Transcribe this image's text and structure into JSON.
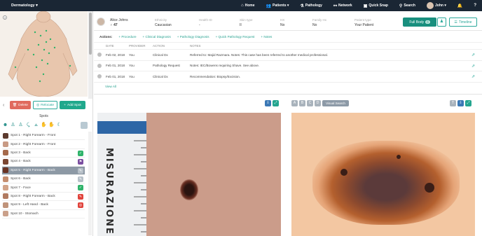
{
  "nav": {
    "brand": "Dermatology ▾",
    "items": [
      {
        "label": "Home",
        "icon": "home-icon"
      },
      {
        "label": "Patients ▾",
        "icon": "users-icon"
      },
      {
        "label": "Pathology",
        "icon": "flask-icon"
      },
      {
        "label": "Network",
        "icon": "network-icon"
      },
      {
        "label": "Quick Snap",
        "icon": "camera-icon"
      },
      {
        "label": "Search",
        "icon": "search-icon"
      }
    ],
    "user": "John ▾"
  },
  "left": {
    "delete": "Delete",
    "relocate": "Relocate",
    "add_spot": "Add Spot",
    "spots_title": "Spots",
    "spots": [
      {
        "label": "Spot 1 - Right Forearm - Front",
        "status": ""
      },
      {
        "label": "Spot 2 - Right Forearm - Front",
        "status": ""
      },
      {
        "label": "Spot 3 - Back",
        "status": "green"
      },
      {
        "label": "Spot 4 - Back",
        "status": "purple"
      },
      {
        "label": "Spot 5 - Right Forearm - Back",
        "status": "gray",
        "selected": true
      },
      {
        "label": "Spot 6 - Back",
        "status": "gray"
      },
      {
        "label": "Spot 7 - Face",
        "status": "green"
      },
      {
        "label": "Spot 8 - Right Forearm - Back",
        "status": "red"
      },
      {
        "label": "Spot 9 - Left Hand - Back",
        "status": "red"
      },
      {
        "label": "Spot 10 - Stomach",
        "status": ""
      }
    ]
  },
  "patient": {
    "name": "Alice Johns",
    "age": "47",
    "fields": [
      {
        "label": "Ethnicity",
        "value": "Caucasian"
      },
      {
        "label": "Health ID",
        "value": "-"
      },
      {
        "label": "Skin type",
        "value": "II"
      },
      {
        "label": "HX",
        "value": "No"
      },
      {
        "label": "Family Hx",
        "value": "No"
      },
      {
        "label": "Patient type",
        "value": "Your Patient"
      }
    ],
    "full_body": "Full Body",
    "full_body_count": "0",
    "timeline": "Timeline"
  },
  "actions": {
    "heading": "Actions:",
    "links": [
      "+ Procedure",
      "+ Clinical Diagnosis",
      "+ Pathology Diagnosis",
      "+ Quick Pathology Request",
      "+ Notes"
    ]
  },
  "timeline": {
    "headers": [
      "DATE",
      "PROVIDER",
      "ACTION",
      "NOTES"
    ],
    "rows": [
      {
        "date": "Feb 02, 2018",
        "provider": "You",
        "action": "Clinical Dx",
        "notes": "Referred to: Majid Razmara. Notes: This case has been referred to another medical professional."
      },
      {
        "date": "Feb 01, 2018",
        "provider": "You",
        "action": "Pathology Request",
        "notes": "Notes: IEC/Bowens requiring Shave. See above."
      },
      {
        "date": "Feb 01, 2018",
        "provider": "You",
        "action": "Clinical Dx",
        "notes": "Recommendation: Biopsy/Excision."
      }
    ],
    "view_all": "View All"
  },
  "right_toolbar": {
    "letters": [
      "A",
      "B",
      "C",
      "D"
    ],
    "visual_search": "Visual Search"
  },
  "left_image_ruler_text": "MISURAZIONE",
  "colors": {
    "nav_bg": "#1a2634",
    "accent": "#24a58f",
    "delete_red": "#e06a5e",
    "selected_row": "#8d99a5"
  }
}
